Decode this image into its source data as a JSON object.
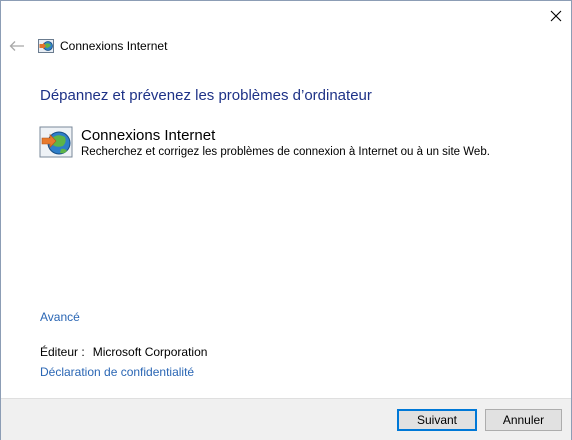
{
  "window": {
    "close_label": "",
    "breadcrumb": "Connexions Internet"
  },
  "main": {
    "heading": "Dépannez et prévenez les problèmes d’ordinateur",
    "item": {
      "title": "Connexions Internet",
      "description": "Recherchez et corrigez les problèmes de connexion à Internet ou à un site Web."
    },
    "advanced_link": "Avancé",
    "publisher_label": "Éditeur :",
    "publisher_value": "Microsoft Corporation",
    "privacy_link": "Déclaration de confidentialité"
  },
  "footer": {
    "next_label": "Suivant",
    "cancel_label": "Annuler"
  },
  "icons": {
    "close": "close-icon",
    "back": "back-arrow-icon",
    "troubleshooter": "internet-connections-icon"
  },
  "colors": {
    "heading": "#1e3287",
    "link": "#2a66b4",
    "footer_bg": "#f0f0f0",
    "primary_button_border": "#0078d7"
  }
}
